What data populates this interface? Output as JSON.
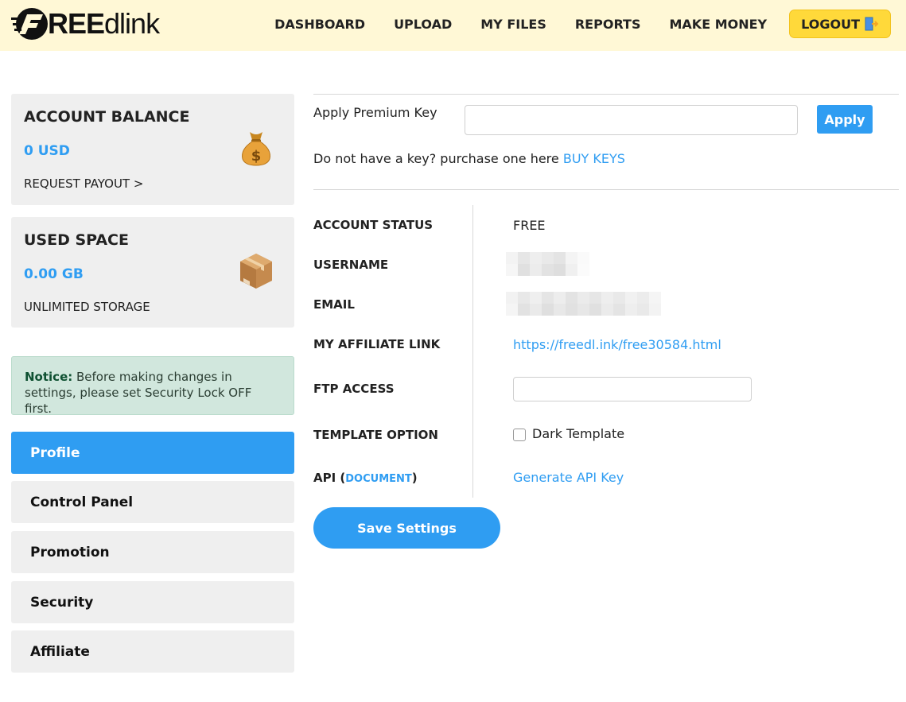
{
  "header": {
    "logo_bold": "REE",
    "logo_thin": "dlink",
    "nav": [
      "DASHBOARD",
      "UPLOAD",
      "MY FILES",
      "REPORTS",
      "MAKE MONEY"
    ],
    "logout_label": "LOGOUT"
  },
  "sidebar": {
    "balance": {
      "title": "ACCOUNT BALANCE",
      "value": "0 USD",
      "link": "REQUEST PAYOUT >",
      "icon": "money-bag-icon"
    },
    "space": {
      "title": "USED SPACE",
      "value": "0.00 GB",
      "sub": "UNLIMITED STORAGE",
      "icon": "package-box-icon"
    },
    "notice": {
      "strong": "Notice:",
      "text": " Before making changes in settings, please set Security Lock OFF first."
    },
    "menu": [
      {
        "label": "Profile",
        "active": true
      },
      {
        "label": "Control Panel",
        "active": false
      },
      {
        "label": "Promotion",
        "active": false
      },
      {
        "label": "Security",
        "active": false
      },
      {
        "label": "Affiliate",
        "active": false
      }
    ]
  },
  "premium": {
    "label": "Apply Premium Key",
    "input_value": "",
    "apply_label": "Apply",
    "buy_text": "Do not have a key? purchase one here ",
    "buy_link": "BUY KEYS"
  },
  "profile": {
    "status_label": "ACCOUNT STATUS",
    "status_value": "FREE",
    "username_label": "USERNAME",
    "email_label": "EMAIL",
    "affiliate_label": "MY AFFILIATE LINK",
    "affiliate_value": "https://freedl.ink/free30584.html",
    "ftp_label": "FTP ACCESS",
    "ftp_value": "",
    "template_label": "TEMPLATE OPTION",
    "template_option": "Dark Template",
    "template_checked": false,
    "api_label_prefix": "API (",
    "api_doc_link": "DOCUMENT",
    "api_label_suffix": ")",
    "api_value": "Generate API Key"
  },
  "save_label": "Save Settings",
  "colors": {
    "accent": "#2f9df2",
    "header_bg": "#fff8d6",
    "logout_bg": "#ffd93a",
    "notice_bg": "#d1e7dd"
  }
}
